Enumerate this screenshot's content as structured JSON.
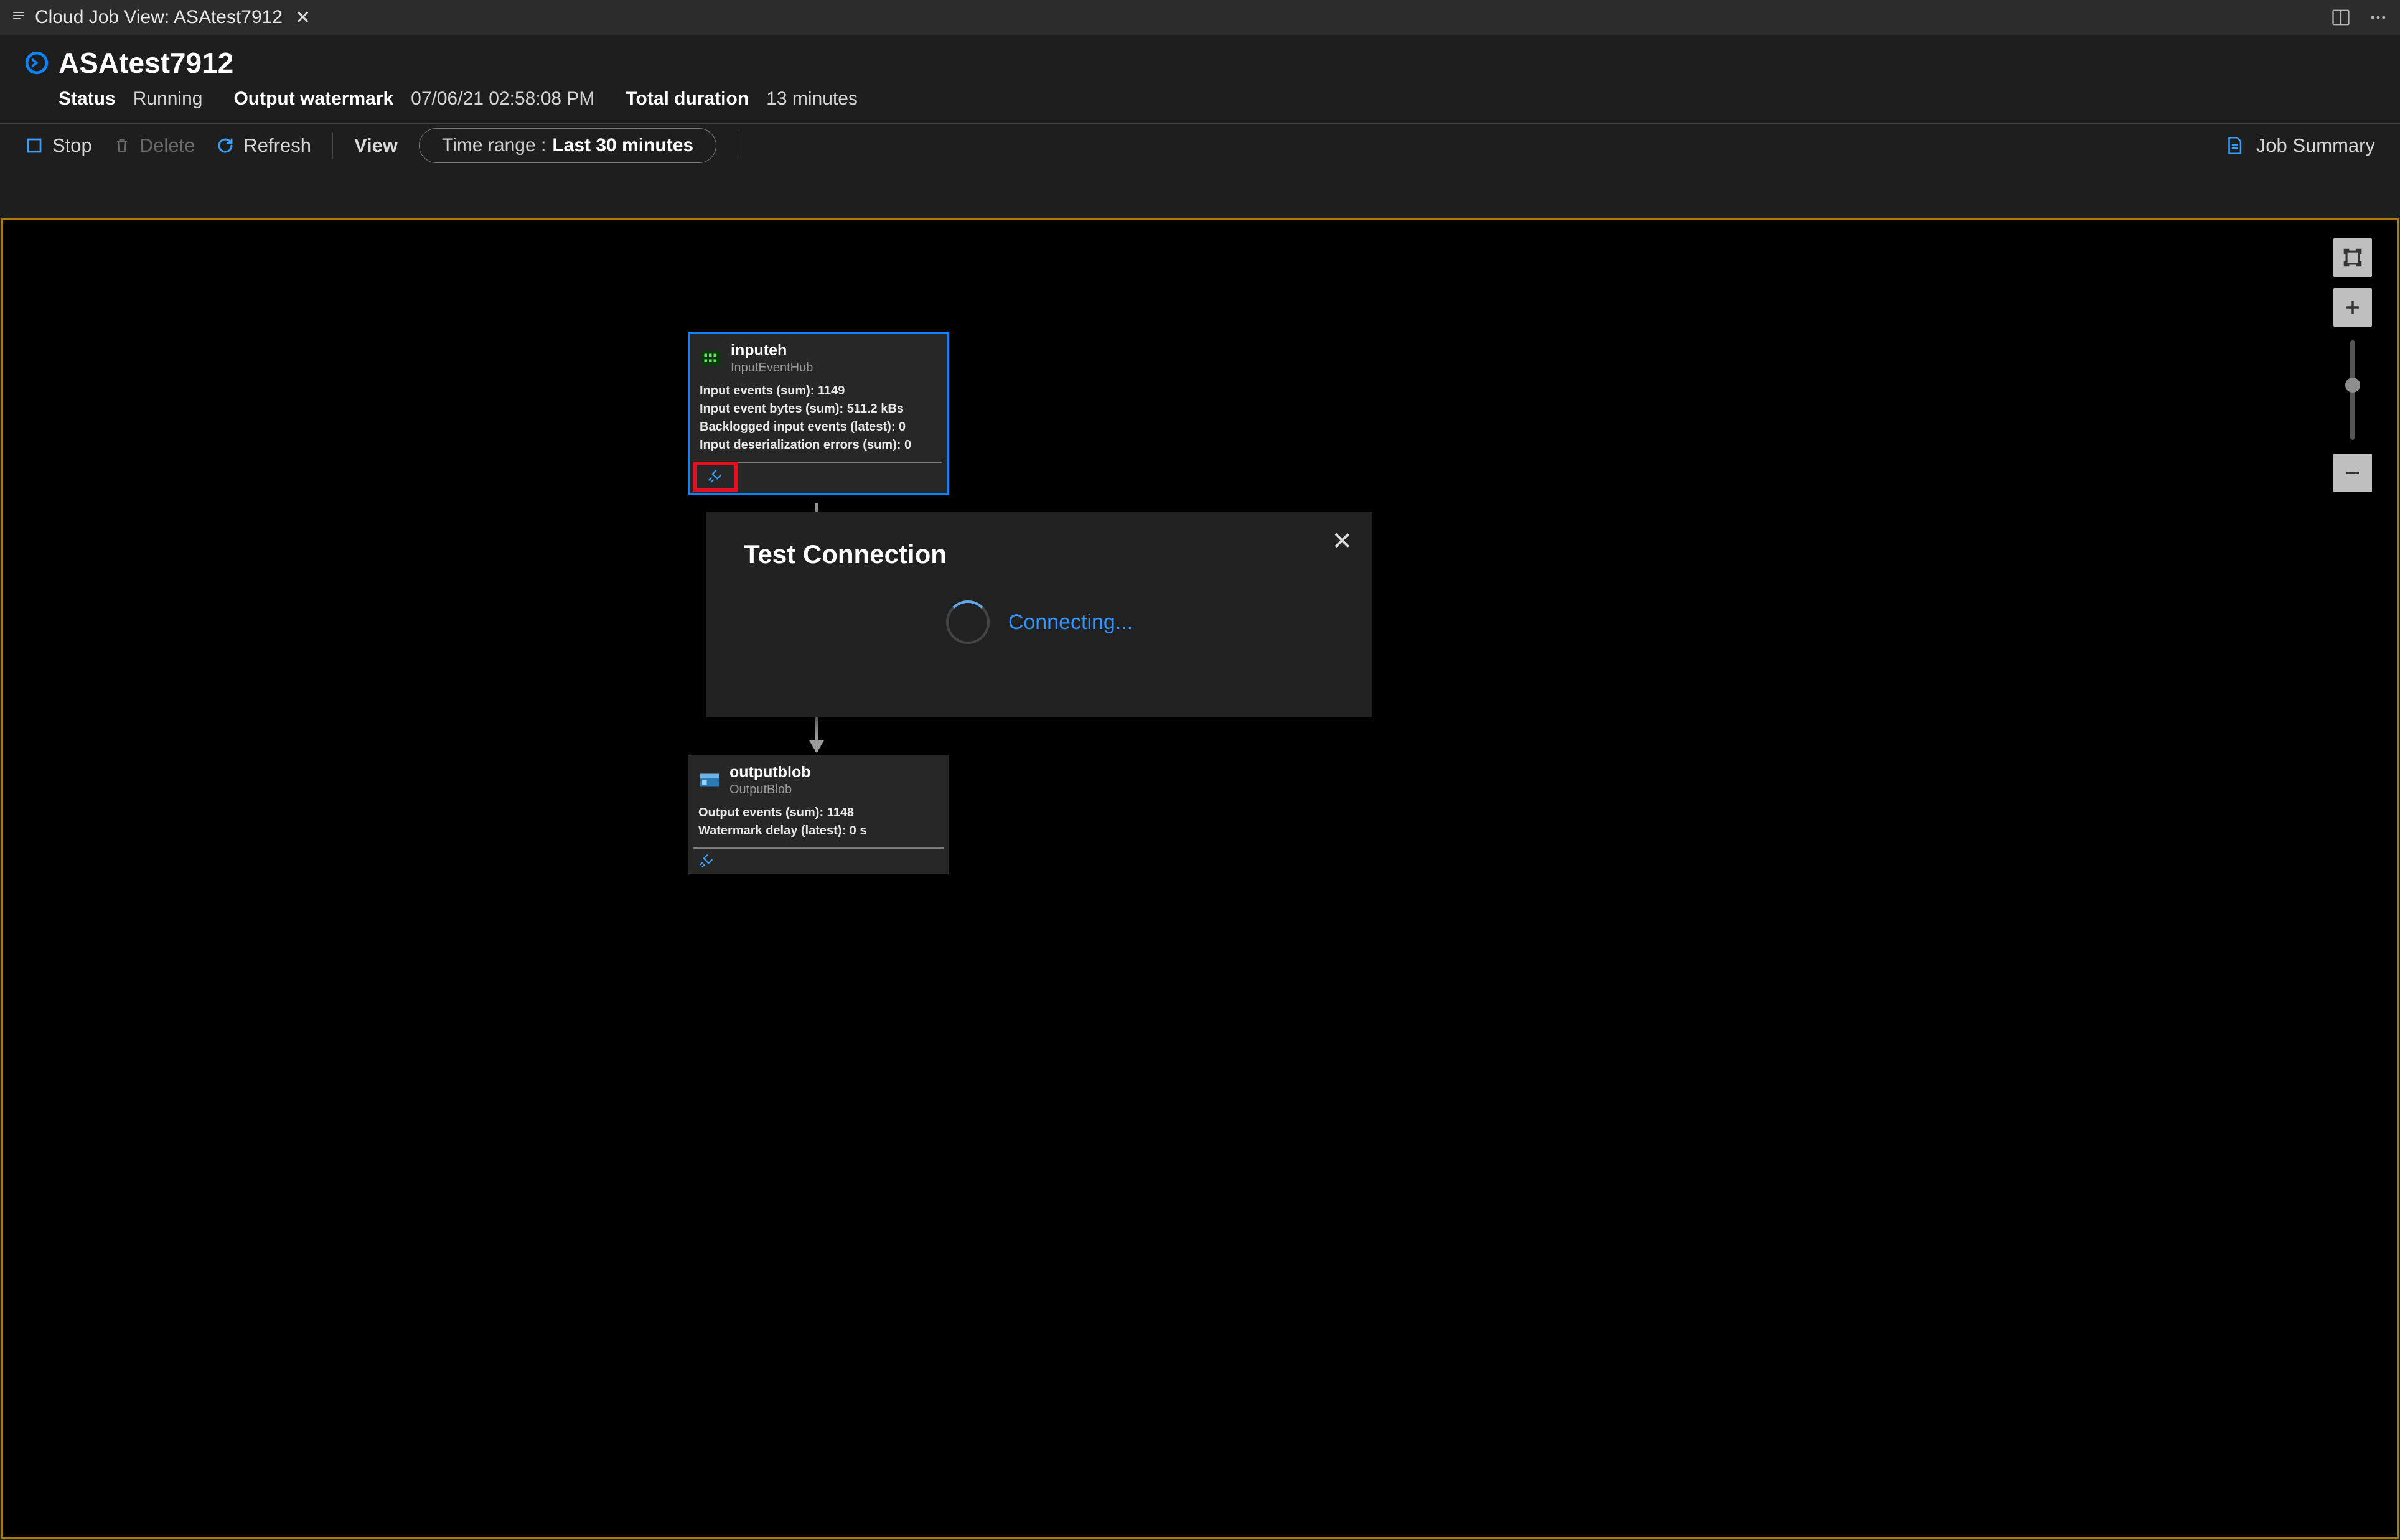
{
  "tab": {
    "title": "Cloud Job View: ASAtest7912"
  },
  "header": {
    "job_name": "ASAtest7912",
    "status_label": "Status",
    "status_value": "Running",
    "watermark_label": "Output watermark",
    "watermark_value": "07/06/21 02:58:08 PM",
    "duration_label": "Total duration",
    "duration_value": "13 minutes"
  },
  "toolbar": {
    "stop": "Stop",
    "delete": "Delete",
    "refresh": "Refresh",
    "view": "View",
    "timerange_label": "Time range :",
    "timerange_value": "Last 30 minutes",
    "summary": "Job Summary"
  },
  "nodes": {
    "input": {
      "title": "inputeh",
      "subtitle": "InputEventHub",
      "metrics": [
        "Input events (sum): 1149",
        "Input event bytes (sum): 511.2 kBs",
        "Backlogged input events (latest): 0",
        "Input deserialization errors (sum): 0"
      ]
    },
    "output": {
      "title": "outputblob",
      "subtitle": "OutputBlob",
      "metrics": [
        "Output events (sum): 1148",
        "Watermark delay (latest): 0 s"
      ]
    }
  },
  "popup": {
    "title": "Test Connection",
    "status": "Connecting..."
  },
  "colors": {
    "accent": "#0185ff",
    "highlight_red": "#e81123",
    "canvas_border": "#b07a00"
  }
}
